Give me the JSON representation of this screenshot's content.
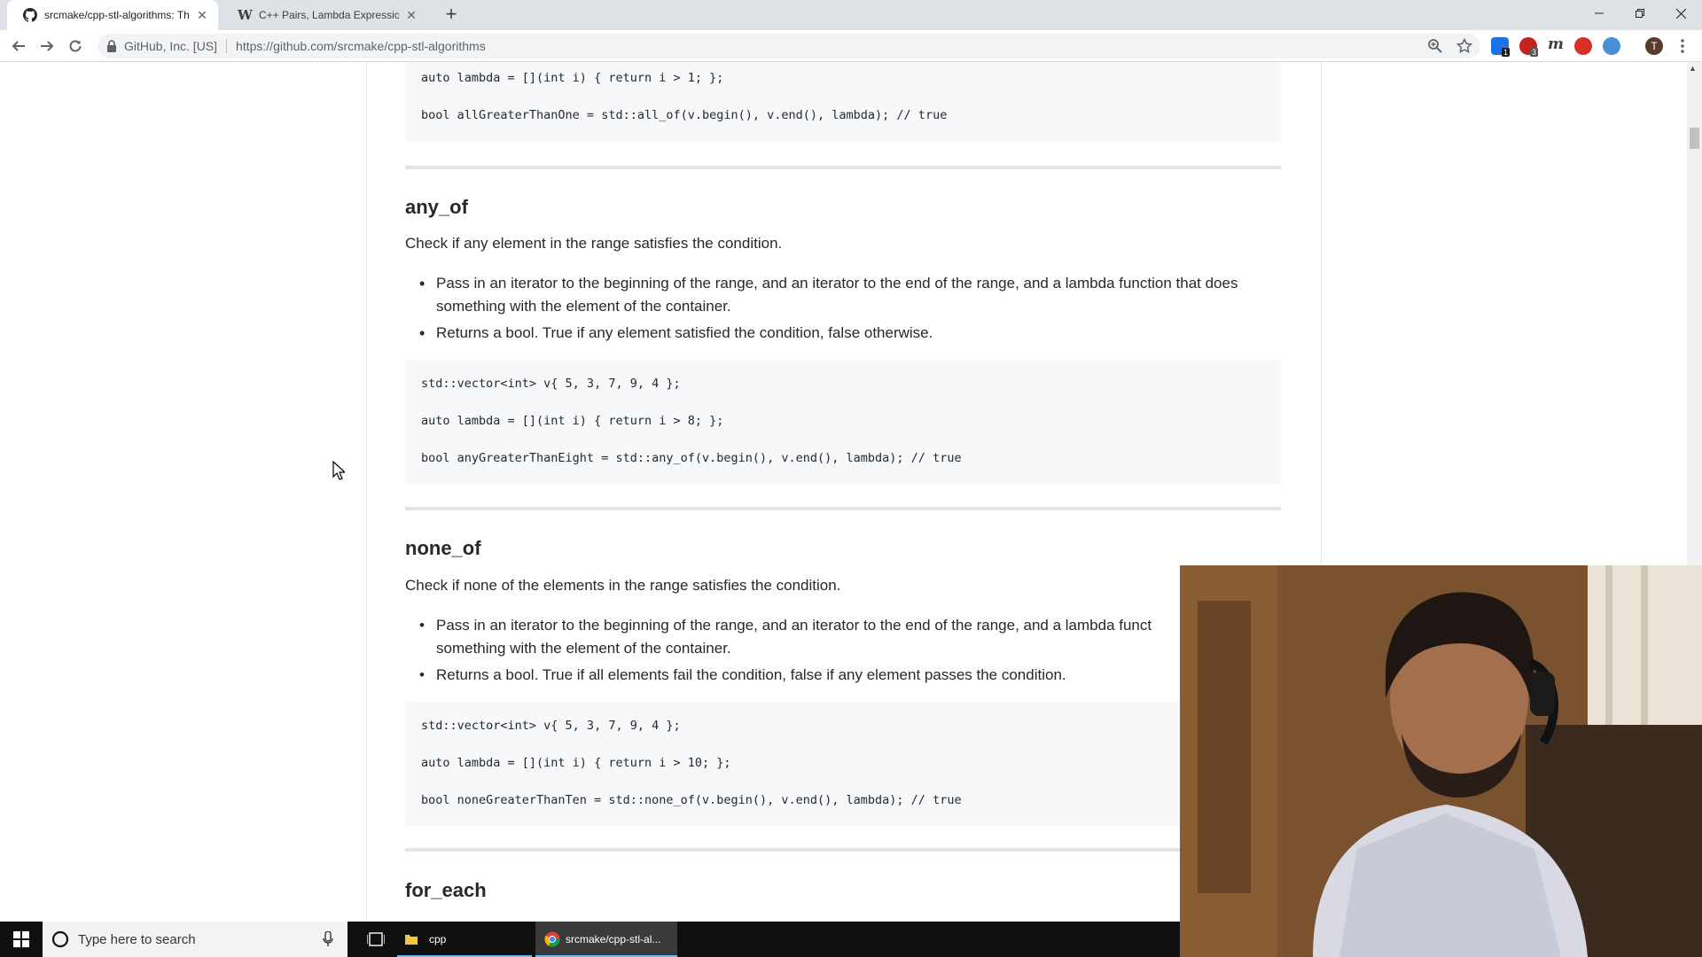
{
  "browser": {
    "tabs": [
      {
        "title": "srcmake/cpp-stl-algorithms: This",
        "icon": "github-icon",
        "active": true
      },
      {
        "title": "C++ Pairs, Lambda Expressions, a",
        "icon": "wikipedia-icon",
        "active": false
      }
    ],
    "new_tab_label": "+",
    "origin": "GitHub, Inc. [US]",
    "url": "https://github.com/srcmake/cpp-stl-algorithms",
    "profile_initial": "T",
    "extension_badges": [
      "1",
      "3"
    ]
  },
  "article": {
    "top_code": [
      "auto lambda = [](int i) { return i > 1; };",
      "bool allGreaterThanOne = std::all_of(v.begin(), v.end(), lambda); // true"
    ],
    "sections": [
      {
        "title": "any_of",
        "description": "Check if any element in the range satisfies the condition.",
        "bullets": [
          "Pass in an iterator to the beginning of the range, and an iterator to the end of the range, and a lambda function that does something with the element of the container.",
          "Returns a bool. True if any element satisfied the condition, false otherwise."
        ],
        "code": [
          "std::vector<int> v{ 5, 3, 7, 9, 4 };",
          "auto lambda = [](int i) { return i > 8; };",
          "bool anyGreaterThanEight = std::any_of(v.begin(), v.end(), lambda); // true"
        ]
      },
      {
        "title": "none_of",
        "description": "Check if none of the elements in the range satisfies the condition.",
        "bullets": [
          "Pass in an iterator to the beginning of the range, and an iterator to the end of the range, and a lambda funct",
          "Returns a bool. True if all elements fail the condition, false if any element passes the condition."
        ],
        "bullet_first_line_tail": "something with the element of the container.",
        "code": [
          "std::vector<int> v{ 5, 3, 7, 9, 4 };",
          "auto lambda = [](int i) { return i > 10; };",
          "bool noneGreaterThanTen = std::none_of(v.begin(), v.end(), lambda); // true"
        ]
      },
      {
        "title": "for_each"
      }
    ]
  },
  "taskbar": {
    "search_placeholder": "Type here to search",
    "items": [
      {
        "label": "cpp",
        "icon": "folder-icon"
      },
      {
        "label": "srcmake/cpp-stl-al...",
        "icon": "chrome-icon"
      }
    ]
  },
  "colors": {
    "code_bg": "#f6f8fa",
    "rule": "#e1e4e8",
    "tab_strip": "#dee1e6",
    "taskbar": "#101010"
  }
}
